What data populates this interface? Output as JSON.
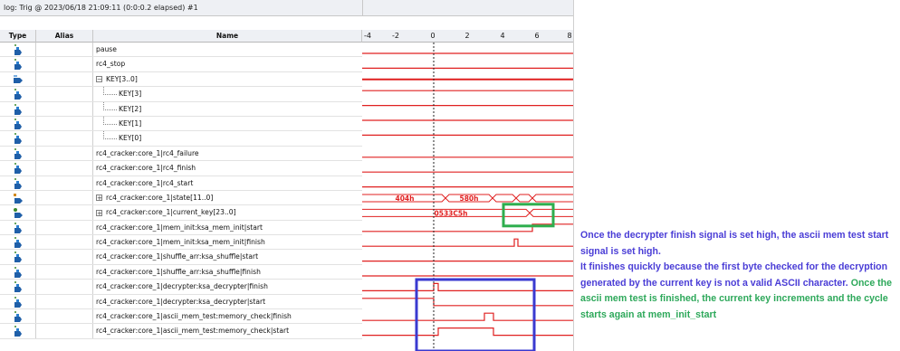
{
  "log": {
    "title": "log: Trig @ 2023/06/18 21:09:11 (0:0:0.2 elapsed) #1"
  },
  "columns": {
    "type": "Type",
    "alias": "Alias",
    "name": "Name"
  },
  "timeline": {
    "ticks": [
      "-4",
      "-2",
      "0",
      "2",
      "4",
      "6",
      "8"
    ]
  },
  "signals": [
    {
      "name": "pause",
      "icon": "input-pin-icon",
      "indent": 0
    },
    {
      "name": "rc4_stop",
      "icon": "input-pin-icon",
      "indent": 0
    },
    {
      "name": "KEY[3..0]",
      "icon": "bus-input-icon",
      "indent": 0,
      "expander": "−"
    },
    {
      "name": "KEY[3]",
      "icon": "input-pin-icon",
      "indent": 1
    },
    {
      "name": "KEY[2]",
      "icon": "input-pin-icon",
      "indent": 1
    },
    {
      "name": "KEY[1]",
      "icon": "input-pin-icon",
      "indent": 1
    },
    {
      "name": "KEY[0]",
      "icon": "input-pin-icon",
      "indent": 1
    },
    {
      "name": "rc4_cracker:core_1|rc4_failure",
      "icon": "input-pin-icon",
      "indent": 0
    },
    {
      "name": "rc4_cracker:core_1|rc4_finish",
      "icon": "input-pin-icon",
      "indent": 0
    },
    {
      "name": "rc4_cracker:core_1|rc4_start",
      "icon": "input-pin-icon",
      "indent": 0
    },
    {
      "name": "rc4_cracker:core_1|state[11..0]",
      "icon": "bus-state-icon",
      "indent": 0,
      "expander": "+"
    },
    {
      "name": "rc4_cracker:core_1|current_key[23..0]",
      "icon": "bus-key-icon",
      "indent": 0,
      "expander": "+"
    },
    {
      "name": "rc4_cracker:core_1|mem_init:ksa_mem_init|start",
      "icon": "input-pin-icon",
      "indent": 0
    },
    {
      "name": "rc4_cracker:core_1|mem_init:ksa_mem_init|finish",
      "icon": "input-pin-icon",
      "indent": 0
    },
    {
      "name": "rc4_cracker:core_1|shuffle_arr:ksa_shuffle|start",
      "icon": "input-pin-icon",
      "indent": 0
    },
    {
      "name": "rc4_cracker:core_1|shuffle_arr:ksa_shuffle|finish",
      "icon": "input-pin-icon",
      "indent": 0
    },
    {
      "name": "rc4_cracker:core_1|decrypter:ksa_decrypter|finish",
      "icon": "input-pin-icon",
      "indent": 0
    },
    {
      "name": "rc4_cracker:core_1|decrypter:ksa_decrypter|start",
      "icon": "input-pin-icon",
      "indent": 0
    },
    {
      "name": "rc4_cracker:core_1|ascii_mem_test:memory_check|finish",
      "icon": "input-pin-icon",
      "indent": 0
    },
    {
      "name": "rc4_cracker:core_1|ascii_mem_test:memory_check|start",
      "icon": "input-pin-icon",
      "indent": 0
    }
  ],
  "bus_values": {
    "state_a": "404h",
    "state_b": "580h",
    "key": "0533C5h"
  },
  "annotation": {
    "blue_1": "Once the decrypter finish signal is set high, the ascii mem test start signal is set high.",
    "blue_2": "It finishes quickly because the first byte checked for the decryption generated by the current key is not a valid ASCII character.",
    "green_1": "Once the ascii mem test is finished, the current key increments and the cycle starts again at mem_init_start"
  },
  "colors": {
    "wave": "#e02020",
    "highlight_green": "#2eae4e",
    "highlight_blue": "#3a3ad0",
    "annotation_blue": "#4a3dd6",
    "annotation_green": "#2da85a"
  }
}
